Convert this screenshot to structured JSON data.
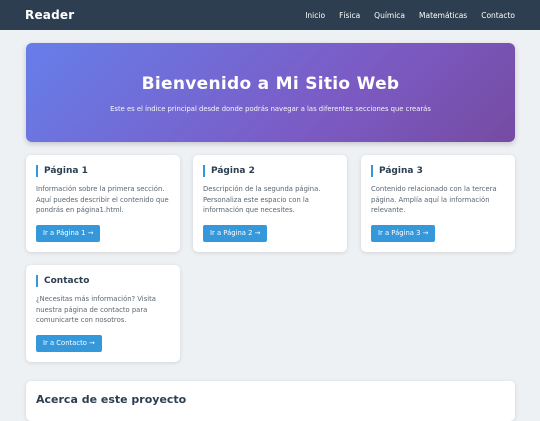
{
  "navbar": {
    "brand": "Reader",
    "links": [
      "Inicio",
      "Física",
      "Química",
      "Matemáticas",
      "Contacto"
    ]
  },
  "hero": {
    "title": "Bienvenido a Mi Sitio Web",
    "subtitle": "Este es el índice principal desde donde podrás navegar a las diferentes secciones que crearás"
  },
  "cards": [
    {
      "title": "Página 1",
      "text": "Información sobre la primera sección. Aquí puedes describir el contenido que pondrás en página1.html.",
      "button": "Ir a Página 1 →"
    },
    {
      "title": "Página 2",
      "text": "Descripción de la segunda página. Personaliza este espacio con la información que necesites.",
      "button": "Ir a Página 2 →"
    },
    {
      "title": "Página 3",
      "text": "Contenido relacionado con la tercera página. Amplía aquí la información relevante.",
      "button": "Ir a Página 3 →"
    },
    {
      "title": "Contacto",
      "text": "¿Necesitas más información? Visita nuestra página de contacto para comunicarte con nosotros.",
      "button": "Ir a Contacto →"
    }
  ],
  "about": {
    "title": "Acerca de este proyecto"
  }
}
